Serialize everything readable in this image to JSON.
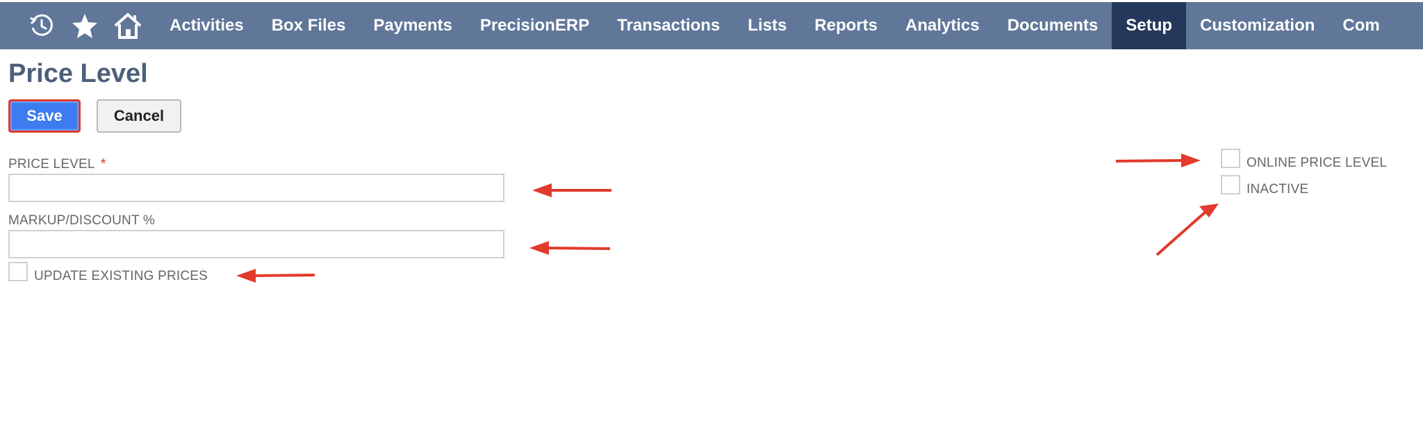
{
  "navbar": {
    "icons": [
      "recent-records-icon",
      "star-icon",
      "home-icon"
    ],
    "items": [
      {
        "label": "Activities",
        "active": false
      },
      {
        "label": "Box Files",
        "active": false
      },
      {
        "label": "Payments",
        "active": false
      },
      {
        "label": "PrecisionERP",
        "active": false
      },
      {
        "label": "Transactions",
        "active": false
      },
      {
        "label": "Lists",
        "active": false
      },
      {
        "label": "Reports",
        "active": false
      },
      {
        "label": "Analytics",
        "active": false
      },
      {
        "label": "Documents",
        "active": false
      },
      {
        "label": "Setup",
        "active": true
      },
      {
        "label": "Customization",
        "active": false
      },
      {
        "label": "Com",
        "active": false
      }
    ]
  },
  "page": {
    "title": "Price Level"
  },
  "buttons": {
    "save": "Save",
    "cancel": "Cancel"
  },
  "form": {
    "price_level_label": "PRICE LEVEL",
    "required_marker": "*",
    "price_level_value": "",
    "markup_label": "MARKUP/DISCOUNT %",
    "markup_value": "",
    "update_existing_label": "UPDATE EXISTING PRICES",
    "update_existing_checked": false,
    "online_price_level_label": "ONLINE PRICE LEVEL",
    "online_price_level_checked": false,
    "inactive_label": "INACTIVE",
    "inactive_checked": false
  },
  "colors": {
    "navbar": "#607799",
    "navbar_active": "#25375a",
    "save_button": "#3d7bf0",
    "highlight_red": "#e23a2c",
    "title": "#4d5f7c"
  }
}
